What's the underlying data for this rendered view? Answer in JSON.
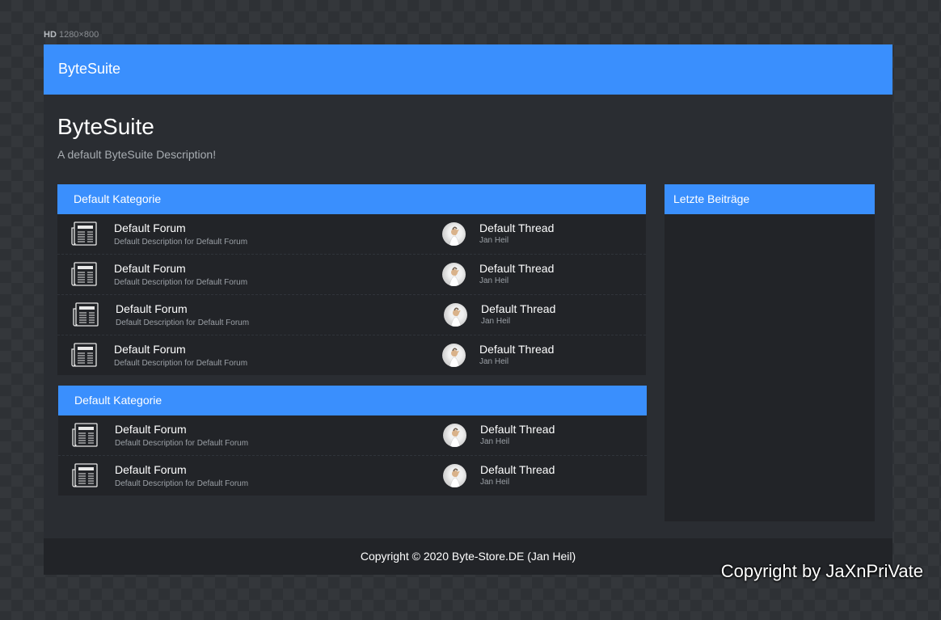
{
  "resolution": {
    "tag": "HD",
    "size": "1280×800"
  },
  "navbar": {
    "brand": "ByteSuite"
  },
  "header": {
    "title": "ByteSuite",
    "description": "A default ByteSuite Description!"
  },
  "categories": [
    {
      "title": "Default Kategorie",
      "forums": [
        {
          "icon": "newspaper-icon",
          "name": "Default Forum",
          "description": "Default Description for Default Forum",
          "last_thread": "Default Thread",
          "last_author": "Jan Heil"
        },
        {
          "icon": "newspaper-icon",
          "name": "Default Forum",
          "description": "Default Description for Default Forum",
          "last_thread": "Default Thread",
          "last_author": "Jan Heil"
        },
        {
          "icon": "newspaper-icon",
          "name": "Default Forum",
          "description": "Default Description for Default Forum",
          "last_thread": "Default Thread",
          "last_author": "Jan Heil"
        },
        {
          "icon": "newspaper-icon",
          "name": "Default Forum",
          "description": "Default Description for Default Forum",
          "last_thread": "Default Thread",
          "last_author": "Jan Heil"
        }
      ]
    },
    {
      "title": "Default Kategorie",
      "forums": [
        {
          "icon": "newspaper-icon",
          "name": "Default Forum",
          "description": "Default Description for Default Forum",
          "last_thread": "Default Thread",
          "last_author": "Jan Heil"
        },
        {
          "icon": "newspaper-icon",
          "name": "Default Forum",
          "description": "Default Description for Default Forum",
          "last_thread": "Default Thread",
          "last_author": "Jan Heil"
        }
      ]
    }
  ],
  "sidebar": {
    "title": "Letzte Beiträge"
  },
  "footer": {
    "copyright": "Copyright © 2020 Byte-Store.DE (Jan Heil)"
  },
  "watermark": "Copyright by JaXnPriVate",
  "colors": {
    "accent": "#3a8ffd",
    "panel": "#222428",
    "frame": "#2a2d32",
    "muted_text": "#9ba0a6"
  }
}
